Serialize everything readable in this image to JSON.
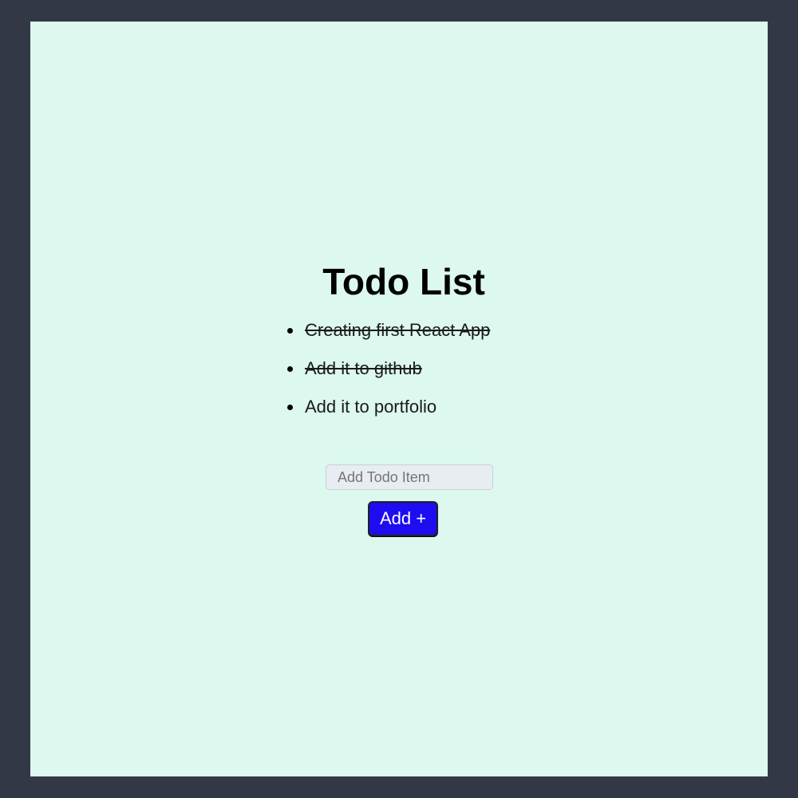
{
  "app": {
    "title": "Todo List",
    "colors": {
      "page_background": "#323845",
      "card_background": "#dcf8ef",
      "button_background": "#1d0df0",
      "button_text": "#ffffff",
      "input_background": "#e8edf1"
    }
  },
  "todos": [
    {
      "text": "Creating first React App",
      "completed": true
    },
    {
      "text": "Add it to github",
      "completed": true
    },
    {
      "text": "Add it to portfolio",
      "completed": false
    }
  ],
  "form": {
    "input_value": "",
    "input_placeholder": "Add Todo Item",
    "add_button_label": "Add +"
  }
}
